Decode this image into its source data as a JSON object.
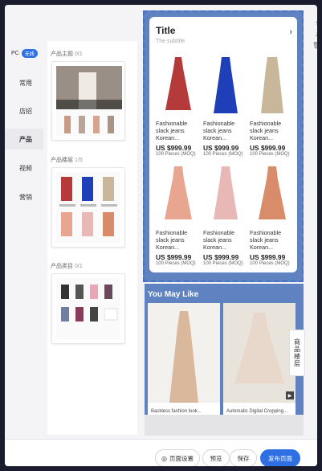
{
  "nav": {
    "pc_label": "PC",
    "wireless_label": "无线",
    "items": [
      "常用",
      "店招",
      "产品",
      "视频",
      "营销"
    ],
    "active_index": 2
  },
  "panel": {
    "sections": [
      {
        "title": "产品主题",
        "count": "0/1"
      },
      {
        "title": "产品楼层",
        "count": "1/5"
      },
      {
        "title": "产品类目",
        "count": "0/1"
      }
    ]
  },
  "floor": {
    "title": "Title",
    "subtitle": "The subtitle",
    "arrow": "›",
    "products": [
      {
        "name": "Fashionable slack jeans Korean...",
        "price": "US $999.99",
        "moq": "100 Pieces (MOQ)",
        "color": "#b53a3a"
      },
      {
        "name": "Fashionable slack jeans Korean...",
        "price": "US $999.99",
        "moq": "100 Pieces (MOQ)",
        "color": "#1f3fb8"
      },
      {
        "name": "Fashionable slack jeans Korean...",
        "price": "US $999.99",
        "moq": "100 Pieces (MOQ)",
        "color": "#c9b79b"
      },
      {
        "name": "Fashionable slack jeans Korean...",
        "price": "US $999.99",
        "moq": "100 Pieces (MOQ)",
        "color": "#e8a58f"
      },
      {
        "name": "Fashionable slack jeans Korean...",
        "price": "US $999.99",
        "moq": "100 Pieces (MOQ)",
        "color": "#e7b8b5"
      },
      {
        "name": "Fashionable slack jeans Korean...",
        "price": "US $999.99",
        "moq": "100 Pieces (MOQ)",
        "color": "#d98c6a"
      }
    ]
  },
  "you_may_like": {
    "title": "You May Like",
    "items": [
      {
        "caption": "Backless fashion look...",
        "color": "#d9b89c"
      },
      {
        "caption": "Automatic Digital Cropping...",
        "color": "#e8d7cb"
      }
    ]
  },
  "floor_tab": "商品楼层",
  "tools": [
    "↑",
    "↓",
    "🗑"
  ],
  "bottom": {
    "page_settings": "页面设置",
    "preview": "预览",
    "save": "保存",
    "publish": "发布页面"
  },
  "colors": {
    "accent": "#2f6fe4",
    "floor_bg": "#5e83c0"
  }
}
